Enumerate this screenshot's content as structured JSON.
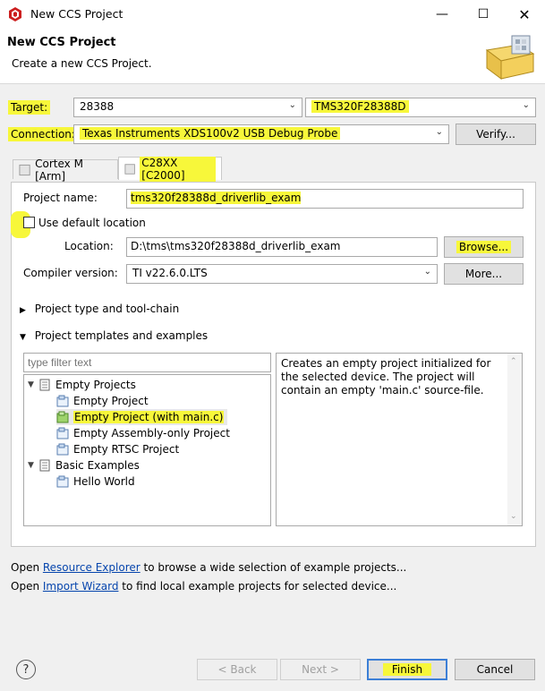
{
  "window": {
    "title": "New CCS Project"
  },
  "header": {
    "title": "New CCS Project",
    "subtitle": "Create a new CCS Project."
  },
  "target": {
    "label": "Target:",
    "family_value": "28388",
    "device_value": "TMS320F28388D"
  },
  "connection": {
    "label": "Connection:",
    "value": "Texas Instruments XDS100v2 USB Debug Probe",
    "verify_label": "Verify..."
  },
  "tabs": [
    {
      "label": "Cortex M [Arm]"
    },
    {
      "label": "C28XX [C2000]"
    }
  ],
  "project": {
    "name_label": "Project name:",
    "name_value": "tms320f28388d_driverlib_exam",
    "use_default_label": "Use default location",
    "use_default_checked": false,
    "location_label": "Location:",
    "location_value": "D:\\tms\\tms320f28388d_driverlib_exam",
    "browse_label": "Browse...",
    "compiler_label": "Compiler version:",
    "compiler_value": "TI v22.6.0.LTS",
    "more_label": "More..."
  },
  "sections": {
    "type_toolchain": "Project type and tool-chain",
    "templates": "Project templates and examples"
  },
  "filter": {
    "placeholder": "type filter text"
  },
  "tree": {
    "groups": [
      {
        "label": "Empty Projects",
        "items": [
          {
            "label": "Empty Project"
          },
          {
            "label": "Empty Project (with main.c)",
            "selected": true
          },
          {
            "label": "Empty Assembly-only Project"
          },
          {
            "label": "Empty RTSC Project"
          }
        ]
      },
      {
        "label": "Basic Examples",
        "items": [
          {
            "label": "Hello World"
          }
        ]
      }
    ]
  },
  "description": "Creates an empty project initialized for the selected device. The project will contain an empty 'main.c' source-file.",
  "footer_links": {
    "line1_pre": "Open ",
    "line1_link": "Resource Explorer",
    "line1_post": " to browse a wide selection of example projects...",
    "line2_pre": "Open ",
    "line2_link": "Import Wizard",
    "line2_post": " to find local example projects for selected device..."
  },
  "buttons": {
    "help": "?",
    "back": "< Back",
    "next": "Next >",
    "finish": "Finish",
    "cancel": "Cancel"
  },
  "icons": {
    "app": "ccs-app-icon",
    "header": "project-wizard-icon",
    "folder": "template-folder-icon",
    "project": "project-icon",
    "accent_highlight": "#f7f73a"
  }
}
